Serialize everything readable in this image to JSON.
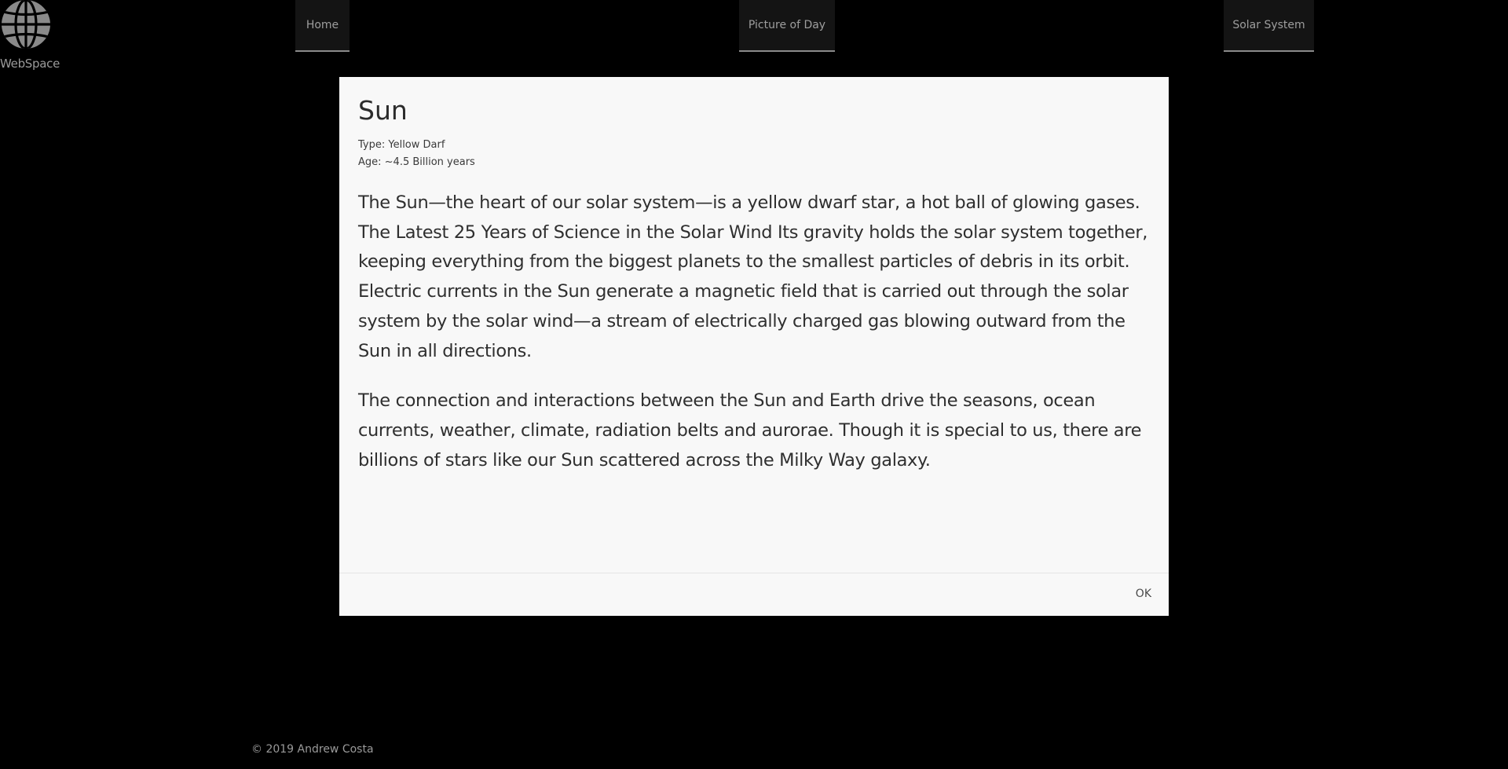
{
  "brand": {
    "label": "WebSpace",
    "icon": "globe-icon",
    "icon_color": "#8a8a8a"
  },
  "nav": {
    "items": [
      {
        "label": "Home"
      },
      {
        "label": "Picture of Day"
      },
      {
        "label": "Solar System"
      }
    ]
  },
  "dialog": {
    "title": "Sun",
    "type_line": "Type: Yellow Darf",
    "age_line": "Age: ~4.5 Billion years",
    "paragraphs": [
      "The Sun—the heart of our solar system—is a yellow dwarf star, a hot ball of glowing gases. The Latest 25 Years of Science in the Solar Wind Its gravity holds the solar system together, keeping everything from the biggest planets to the smallest particles of debris in its orbit. Electric currents in the Sun generate a magnetic field that is carried out through the solar system by the solar wind—a stream of electrically charged gas blowing outward from the Sun in all directions.",
      "The connection and interactions between the Sun and Earth drive the seasons, ocean currents, weather, climate, radiation belts and aurorae. Though it is special to us, there are billions of stars like our Sun scattered across the Milky Way galaxy."
    ],
    "ok_label": "OK"
  },
  "footer": {
    "copyright": "© 2019 Andrew Costa"
  },
  "colors": {
    "background": "#000000",
    "dialog_background": "#f8f8f8",
    "nav_background": "#141414"
  }
}
